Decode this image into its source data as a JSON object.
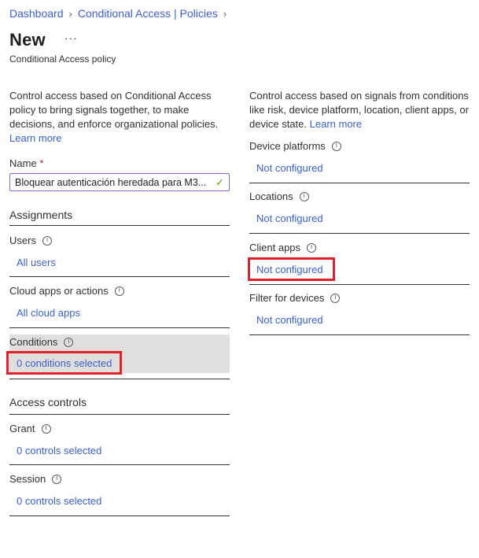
{
  "breadcrumb": {
    "items": [
      "Dashboard",
      "Conditional Access | Policies"
    ]
  },
  "header": {
    "title": "New",
    "more": "···",
    "subtitle": "Conditional Access policy"
  },
  "left": {
    "description": "Control access based on Conditional Access policy to bring signals together, to make decisions, and enforce organizational policies.",
    "learn_more": "Learn more",
    "name_label": "Name",
    "name_required": "*",
    "name_value": "Bloquear autenticación heredada para M3...",
    "assignments_heading": "Assignments",
    "users_label": "Users",
    "users_value": "All users",
    "cloud_label": "Cloud apps or actions",
    "cloud_value": "All cloud apps",
    "conditions_label": "Conditions",
    "conditions_value": "0 conditions selected",
    "access_heading": "Access controls",
    "grant_label": "Grant",
    "grant_value": "0 controls selected",
    "session_label": "Session",
    "session_value": "0 controls selected"
  },
  "right": {
    "description": "Control access based on signals from conditions like risk, device platform, location, client apps, or device state.",
    "learn_more": "Learn more",
    "device_platforms_label": "Device platforms",
    "device_platforms_value": "Not configured",
    "locations_label": "Locations",
    "locations_value": "Not configured",
    "client_apps_label": "Client apps",
    "client_apps_value": "Not configured",
    "filter_label": "Filter for devices",
    "filter_value": "Not configured"
  },
  "icons": {
    "info": "info-icon",
    "check": "checkmark-icon",
    "chevron": "chevron-right-icon"
  },
  "colors": {
    "link": "#3a5fcd",
    "highlight": "#e0202a",
    "selected_bg": "#e1dfdd",
    "input_border": "#8a63d2",
    "valid_check": "#57a300"
  }
}
